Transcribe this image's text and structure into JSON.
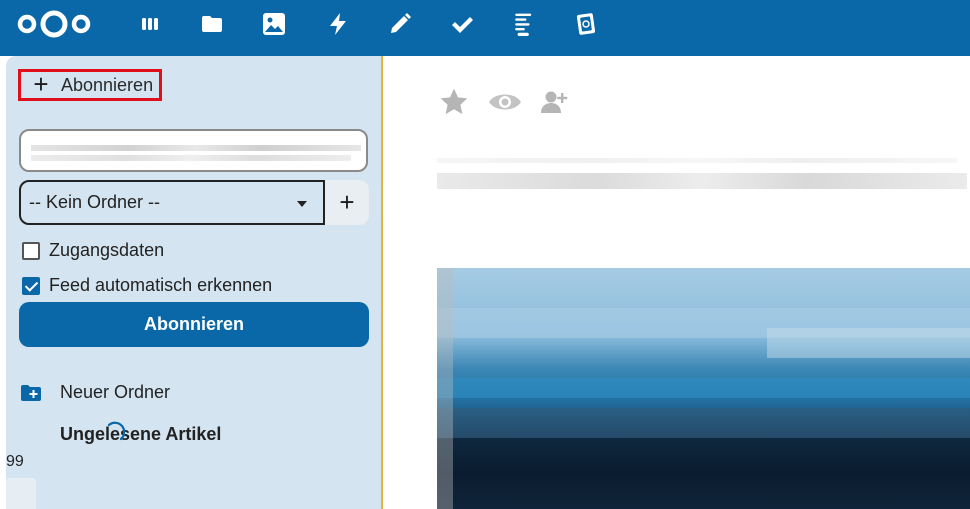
{
  "topbar": {
    "logo": "nextcloud-logo",
    "apps": [
      {
        "name": "dashboard-icon"
      },
      {
        "name": "files-icon"
      },
      {
        "name": "photos-icon"
      },
      {
        "name": "activity-icon"
      },
      {
        "name": "notes-icon"
      },
      {
        "name": "tasks-icon"
      },
      {
        "name": "news-icon"
      },
      {
        "name": "cards-icon"
      }
    ],
    "color": "#0a68a8"
  },
  "sidebar": {
    "new_feed_label": "Abonnieren",
    "url_input_value": "",
    "folder_select_value": "-- Kein Ordner --",
    "add_folder_label": "+",
    "credentials_label": "Zugangsdaten",
    "credentials_checked": false,
    "autodiscover_label": "Feed automatisch erkennen",
    "autodiscover_checked": true,
    "subscribe_button_label": "Abonnieren",
    "new_folder_label": "Neuer Ordner",
    "unread_label": "Ungelesene Artikel",
    "unread_count": "99",
    "accent": "#0a68a8",
    "highlight": "#e0101a"
  },
  "article": {
    "actions": [
      "star-icon",
      "eye-icon",
      "share-user-icon"
    ]
  }
}
